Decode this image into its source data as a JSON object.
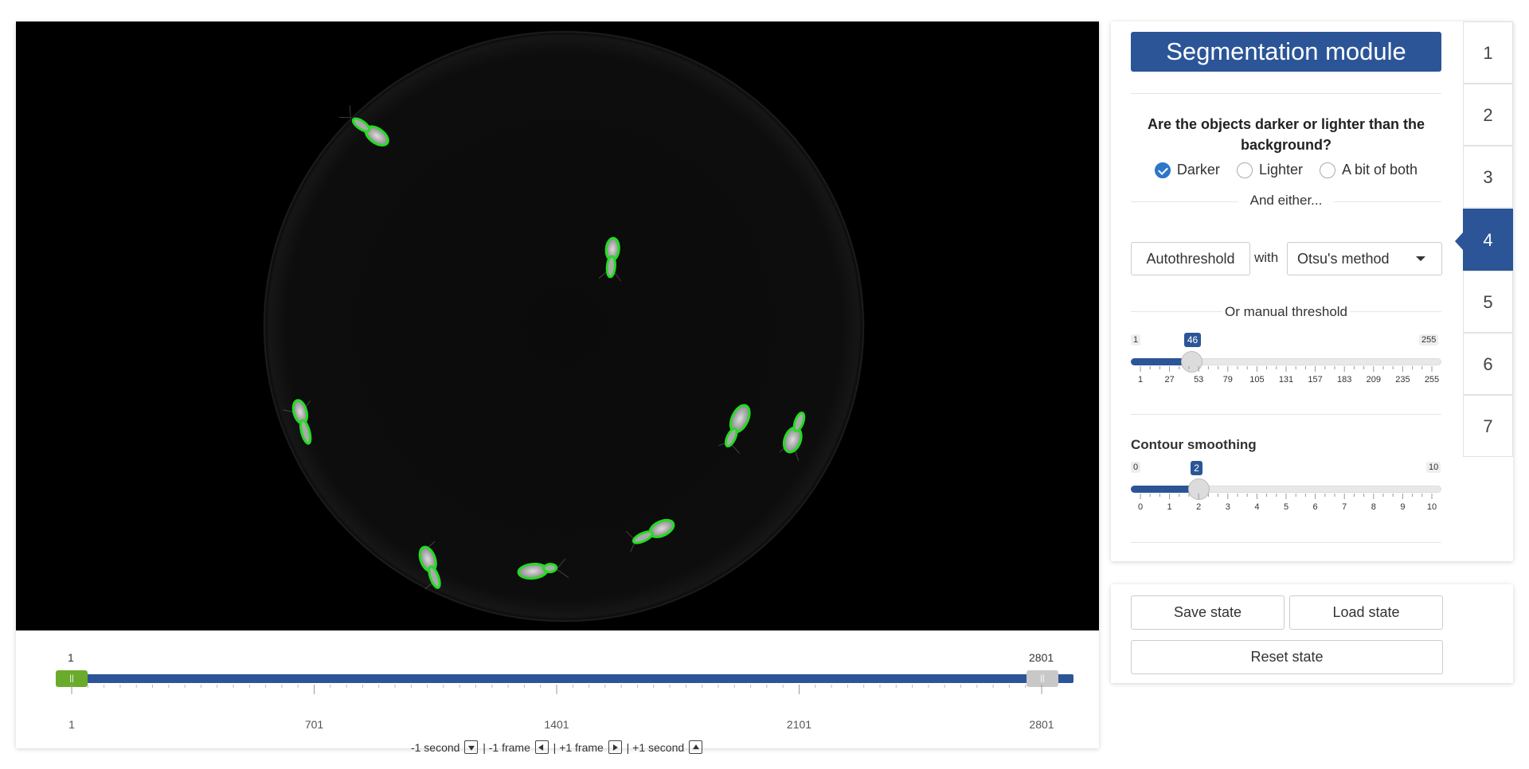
{
  "video": {
    "timeline": {
      "start_value": "1",
      "end_value": "2801",
      "start_handle": "||",
      "end_handle": "||",
      "tick_labels": [
        "1",
        "701",
        "1401",
        "2101",
        "2801"
      ]
    },
    "nav": {
      "minus_second": "-1 second",
      "sep1": "|",
      "minus_frame": "-1 frame",
      "sep2": "|",
      "plus_frame": "+1 frame",
      "sep3": "|",
      "plus_second": "+1 second"
    }
  },
  "module": {
    "title": "Segmentation module",
    "question": "Are the objects darker or lighter than the background?",
    "options": [
      {
        "label": "Darker",
        "checked": true
      },
      {
        "label": "Lighter",
        "checked": false
      },
      {
        "label": "A bit of both",
        "checked": false
      }
    ],
    "and_either": "And either...",
    "autothreshold_label": "Autothreshold",
    "with_label": "with",
    "method_selected": "Otsu's method",
    "manual_label": "Or manual threshold",
    "threshold": {
      "min": "1",
      "max": "255",
      "value": "46",
      "value_num": 46,
      "min_num": 1,
      "max_num": 255,
      "ticks": [
        "1",
        "27",
        "53",
        "79",
        "105",
        "131",
        "157",
        "183",
        "209",
        "235",
        "255"
      ]
    },
    "smoothing_label": "Contour smoothing",
    "smoothing": {
      "min": "0",
      "max": "10",
      "value": "2",
      "value_num": 2,
      "min_num": 0,
      "max_num": 10,
      "ticks": [
        "0",
        "1",
        "2",
        "3",
        "4",
        "5",
        "6",
        "7",
        "8",
        "9",
        "10"
      ]
    }
  },
  "steps": {
    "tabs": [
      "1",
      "2",
      "3",
      "4",
      "5",
      "6",
      "7"
    ],
    "active": "4"
  },
  "state": {
    "save_label": "Save state",
    "load_label": "Load state",
    "reset_label": "Reset state"
  },
  "colors": {
    "accent": "#2b5597",
    "timeline_start_handle": "#6aab2c",
    "contour": "#22dd22",
    "radio_checked": "#2b77c8"
  },
  "icons": {
    "minus_second": "arrow-down-key-icon",
    "minus_frame": "arrow-left-key-icon",
    "plus_frame": "arrow-right-key-icon",
    "plus_second": "arrow-up-key-icon",
    "select_caret": "caret-down-icon",
    "radio_check": "checkmark-icon"
  }
}
